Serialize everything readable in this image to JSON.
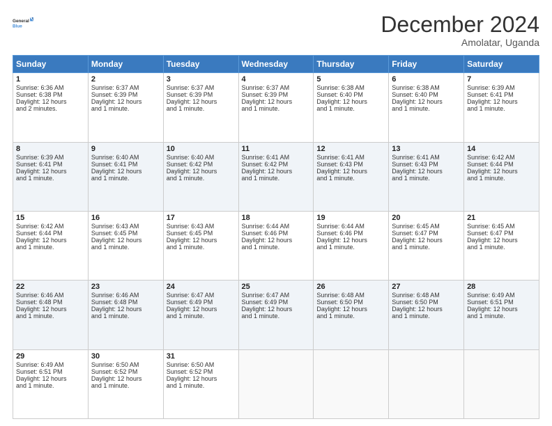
{
  "logo": {
    "line1": "General",
    "line2": "Blue"
  },
  "title": "December 2024",
  "subtitle": "Amolatar, Uganda",
  "days_header": [
    "Sunday",
    "Monday",
    "Tuesday",
    "Wednesday",
    "Thursday",
    "Friday",
    "Saturday"
  ],
  "weeks": [
    [
      {
        "day": "1",
        "sunrise": "6:36 AM",
        "sunset": "6:38 PM",
        "daylight": "12 hours and 2 minutes."
      },
      {
        "day": "2",
        "sunrise": "6:37 AM",
        "sunset": "6:39 PM",
        "daylight": "12 hours and 1 minute."
      },
      {
        "day": "3",
        "sunrise": "6:37 AM",
        "sunset": "6:39 PM",
        "daylight": "12 hours and 1 minute."
      },
      {
        "day": "4",
        "sunrise": "6:37 AM",
        "sunset": "6:39 PM",
        "daylight": "12 hours and 1 minute."
      },
      {
        "day": "5",
        "sunrise": "6:38 AM",
        "sunset": "6:40 PM",
        "daylight": "12 hours and 1 minute."
      },
      {
        "day": "6",
        "sunrise": "6:38 AM",
        "sunset": "6:40 PM",
        "daylight": "12 hours and 1 minute."
      },
      {
        "day": "7",
        "sunrise": "6:39 AM",
        "sunset": "6:41 PM",
        "daylight": "12 hours and 1 minute."
      }
    ],
    [
      {
        "day": "8",
        "sunrise": "6:39 AM",
        "sunset": "6:41 PM",
        "daylight": "12 hours and 1 minute."
      },
      {
        "day": "9",
        "sunrise": "6:40 AM",
        "sunset": "6:41 PM",
        "daylight": "12 hours and 1 minute."
      },
      {
        "day": "10",
        "sunrise": "6:40 AM",
        "sunset": "6:42 PM",
        "daylight": "12 hours and 1 minute."
      },
      {
        "day": "11",
        "sunrise": "6:41 AM",
        "sunset": "6:42 PM",
        "daylight": "12 hours and 1 minute."
      },
      {
        "day": "12",
        "sunrise": "6:41 AM",
        "sunset": "6:43 PM",
        "daylight": "12 hours and 1 minute."
      },
      {
        "day": "13",
        "sunrise": "6:41 AM",
        "sunset": "6:43 PM",
        "daylight": "12 hours and 1 minute."
      },
      {
        "day": "14",
        "sunrise": "6:42 AM",
        "sunset": "6:44 PM",
        "daylight": "12 hours and 1 minute."
      }
    ],
    [
      {
        "day": "15",
        "sunrise": "6:42 AM",
        "sunset": "6:44 PM",
        "daylight": "12 hours and 1 minute."
      },
      {
        "day": "16",
        "sunrise": "6:43 AM",
        "sunset": "6:45 PM",
        "daylight": "12 hours and 1 minute."
      },
      {
        "day": "17",
        "sunrise": "6:43 AM",
        "sunset": "6:45 PM",
        "daylight": "12 hours and 1 minute."
      },
      {
        "day": "18",
        "sunrise": "6:44 AM",
        "sunset": "6:46 PM",
        "daylight": "12 hours and 1 minute."
      },
      {
        "day": "19",
        "sunrise": "6:44 AM",
        "sunset": "6:46 PM",
        "daylight": "12 hours and 1 minute."
      },
      {
        "day": "20",
        "sunrise": "6:45 AM",
        "sunset": "6:47 PM",
        "daylight": "12 hours and 1 minute."
      },
      {
        "day": "21",
        "sunrise": "6:45 AM",
        "sunset": "6:47 PM",
        "daylight": "12 hours and 1 minute."
      }
    ],
    [
      {
        "day": "22",
        "sunrise": "6:46 AM",
        "sunset": "6:48 PM",
        "daylight": "12 hours and 1 minute."
      },
      {
        "day": "23",
        "sunrise": "6:46 AM",
        "sunset": "6:48 PM",
        "daylight": "12 hours and 1 minute."
      },
      {
        "day": "24",
        "sunrise": "6:47 AM",
        "sunset": "6:49 PM",
        "daylight": "12 hours and 1 minute."
      },
      {
        "day": "25",
        "sunrise": "6:47 AM",
        "sunset": "6:49 PM",
        "daylight": "12 hours and 1 minute."
      },
      {
        "day": "26",
        "sunrise": "6:48 AM",
        "sunset": "6:50 PM",
        "daylight": "12 hours and 1 minute."
      },
      {
        "day": "27",
        "sunrise": "6:48 AM",
        "sunset": "6:50 PM",
        "daylight": "12 hours and 1 minute."
      },
      {
        "day": "28",
        "sunrise": "6:49 AM",
        "sunset": "6:51 PM",
        "daylight": "12 hours and 1 minute."
      }
    ],
    [
      {
        "day": "29",
        "sunrise": "6:49 AM",
        "sunset": "6:51 PM",
        "daylight": "12 hours and 1 minute."
      },
      {
        "day": "30",
        "sunrise": "6:50 AM",
        "sunset": "6:52 PM",
        "daylight": "12 hours and 1 minute."
      },
      {
        "day": "31",
        "sunrise": "6:50 AM",
        "sunset": "6:52 PM",
        "daylight": "12 hours and 1 minute."
      },
      null,
      null,
      null,
      null
    ]
  ],
  "labels": {
    "sunrise": "Sunrise:",
    "sunset": "Sunset:",
    "daylight": "Daylight:"
  }
}
